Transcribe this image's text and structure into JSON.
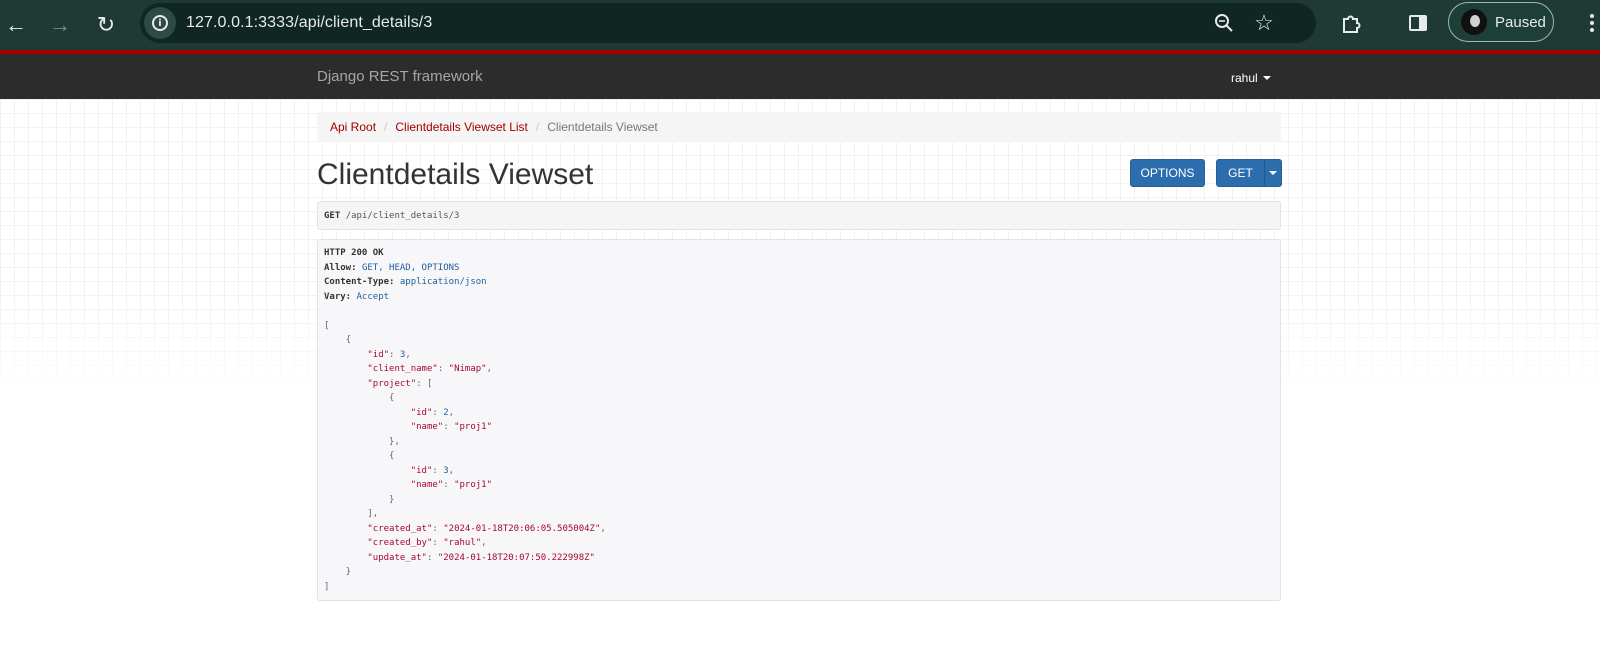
{
  "browser": {
    "url": "127.0.0.1:3333/api/client_details/3",
    "profile_label": "Paused"
  },
  "navbar": {
    "brand": "Django REST framework",
    "user": "rahul"
  },
  "breadcrumb": {
    "items": [
      "Api Root",
      "Clientdetails Viewset List",
      "Clientdetails Viewset"
    ],
    "separator": "/"
  },
  "page": {
    "title": "Clientdetails Viewset",
    "options_button": "OPTIONS",
    "get_button": "GET"
  },
  "request": {
    "method": "GET",
    "path": "/api/client_details/3"
  },
  "response": {
    "status": "HTTP 200 OK",
    "headers": [
      {
        "key": "Allow:",
        "value": "GET, HEAD, OPTIONS"
      },
      {
        "key": "Content-Type:",
        "value": "application/json"
      },
      {
        "key": "Vary:",
        "value": "Accept"
      }
    ],
    "body": {
      "id": "3",
      "client_name": "\"Nimap\"",
      "project": [
        {
          "id": "2",
          "name": "\"proj1\""
        },
        {
          "id": "3",
          "name": "\"proj1\""
        }
      ],
      "created_at": "\"2024-01-18T20:06:05.505004Z\"",
      "created_by": "\"rahul\"",
      "update_at": "\"2024-01-18T20:07:50.222998Z\""
    }
  },
  "colors": {
    "accent_red": "#a30000",
    "button_blue": "#2c6ead",
    "browser_bar": "#1f3a33"
  }
}
